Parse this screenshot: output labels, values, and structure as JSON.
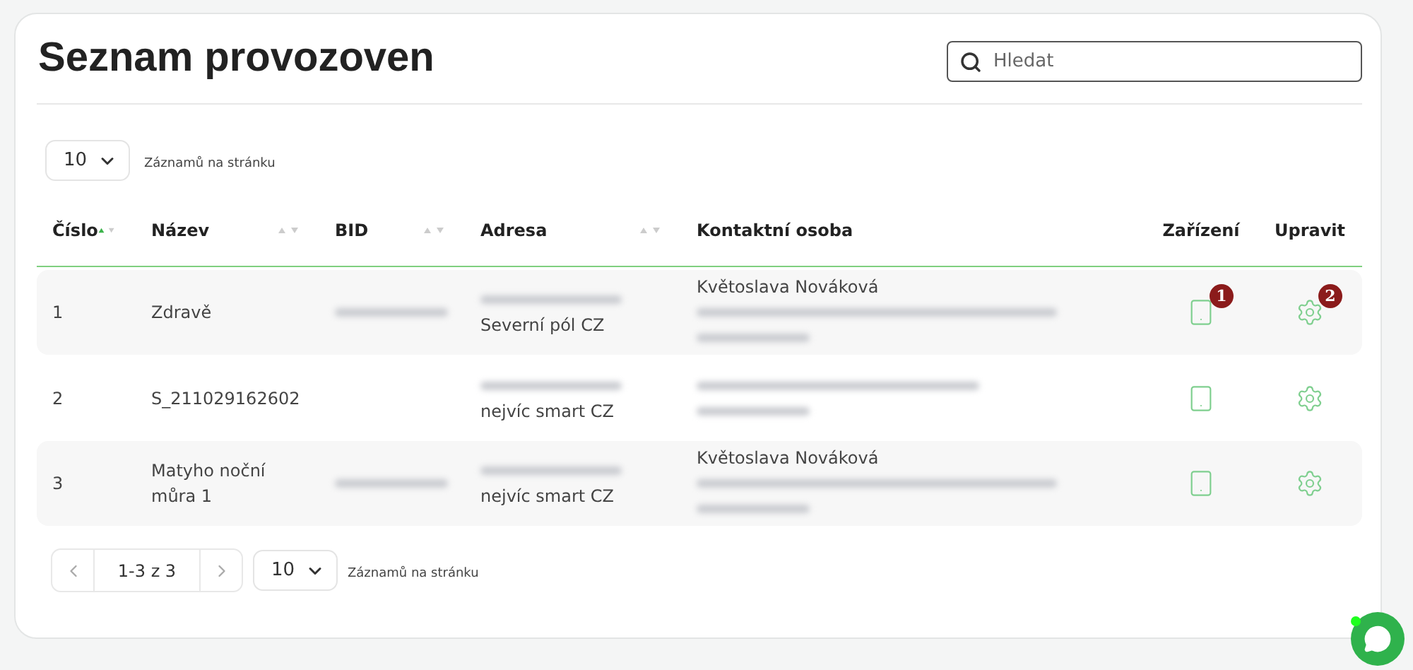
{
  "title": "Seznam provozoven",
  "search": {
    "placeholder": "Hledat"
  },
  "top_page_size": {
    "value": "10",
    "label": "Záznamů na stránku"
  },
  "columns": [
    {
      "label": "Číslo",
      "sorted": true
    },
    {
      "label": "Název",
      "sorted": false
    },
    {
      "label": "BID",
      "sorted": false
    },
    {
      "label": "Adresa",
      "sorted": false
    },
    {
      "label": "Kontaktní osoba"
    },
    {
      "label": "Zařízení"
    },
    {
      "label": "Upravit"
    }
  ],
  "rows": [
    {
      "number": "1",
      "name": "Zdravě",
      "bid_redacted": true,
      "address": [
        {
          "redacted": true
        },
        {
          "text": "Severní pól CZ"
        }
      ],
      "contact": [
        {
          "text": "Květoslava Nováková"
        },
        {
          "redacted": true
        },
        {
          "redacted": true
        }
      ],
      "device_badge": "1",
      "edit_badge": "2"
    },
    {
      "number": "2",
      "name": "S_211029162602",
      "bid_redacted": false,
      "address": [
        {
          "redacted": true
        },
        {
          "text": "nejvíc smart CZ"
        }
      ],
      "contact": [
        {
          "redacted": true
        },
        {
          "redacted": true
        }
      ]
    },
    {
      "number": "3",
      "name": "Matyho noční můra 1",
      "bid_redacted": true,
      "address": [
        {
          "redacted": true
        },
        {
          "text": "nejvíc smart CZ"
        }
      ],
      "contact": [
        {
          "text": "Květoslava Nováková"
        },
        {
          "redacted": true
        },
        {
          "redacted": true
        }
      ]
    }
  ],
  "pagination": {
    "range": "1-3 z 3",
    "page_size": "10",
    "label": "Záznamů na stránku"
  }
}
